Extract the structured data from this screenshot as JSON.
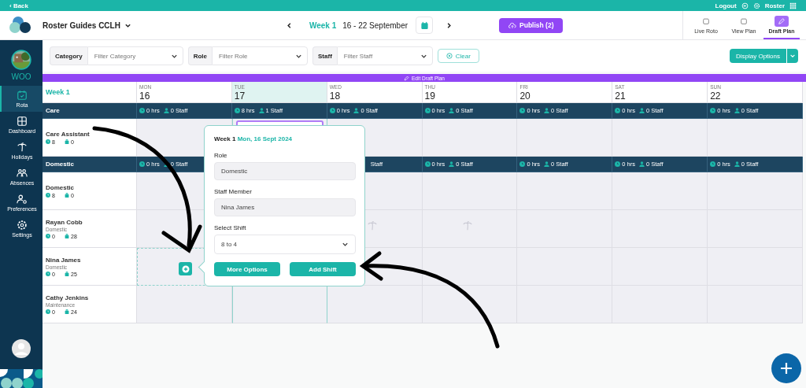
{
  "top_bar": {
    "back": "‹ Back",
    "logout": "Logout",
    "roster": "Roster"
  },
  "header": {
    "org": "Roster Guides CCLH",
    "week_label": "Week 1",
    "week_range": "16 - 22 September",
    "publish": "Publish (2)",
    "views": [
      {
        "label": "Live Roto",
        "selected": false
      },
      {
        "label": "View Plan",
        "selected": false
      },
      {
        "label": "Draft Plan",
        "selected": true
      }
    ]
  },
  "sidebar": {
    "site": "WOO",
    "items": [
      {
        "label": "Rota",
        "selected": true
      },
      {
        "label": "Dashboard",
        "selected": false
      },
      {
        "label": "Holidays",
        "selected": false
      },
      {
        "label": "Absences",
        "selected": false
      },
      {
        "label": "Preferences",
        "selected": false
      },
      {
        "label": "Settings",
        "selected": false
      }
    ]
  },
  "filters": [
    {
      "label": "Category",
      "placeholder": "Filter Category"
    },
    {
      "label": "Role",
      "placeholder": "Filter Role"
    },
    {
      "label": "Staff",
      "placeholder": "Filter Staff"
    }
  ],
  "clear": "Clear",
  "display_options": "Display Options",
  "banner": "Edit Draft Plan",
  "grid": {
    "week": "Week 1",
    "days": [
      {
        "abbr": "MON",
        "date": "16",
        "selected": false
      },
      {
        "abbr": "TUE",
        "date": "17",
        "selected": true
      },
      {
        "abbr": "WED",
        "date": "18",
        "selected": false
      },
      {
        "abbr": "THU",
        "date": "19",
        "selected": false
      },
      {
        "abbr": "FRI",
        "date": "20",
        "selected": false
      },
      {
        "abbr": "SAT",
        "date": "21",
        "selected": false
      },
      {
        "abbr": "SUN",
        "date": "22",
        "selected": false
      }
    ],
    "rows": [
      {
        "kind": "group",
        "name": "Care",
        "totals": [
          {
            "hours": "0 hrs",
            "staff": "0 Staff"
          },
          {
            "hours": "8 hrs",
            "staff": "1 Staff"
          },
          {
            "hours": "0 hrs",
            "staff": "0 Staff"
          },
          {
            "hours": "0 hrs",
            "staff": "0 Staff"
          },
          {
            "hours": "0 hrs",
            "staff": "0 Staff"
          },
          {
            "hours": "0 hrs",
            "staff": "0 Staff"
          },
          {
            "hours": "0 hrs",
            "staff": "0 Staff"
          }
        ]
      },
      {
        "kind": "staff",
        "name": "Care Assistant",
        "hours": "8",
        "count": "0",
        "cells": [
          {
            "kind": "empty"
          },
          {
            "kind": "shift"
          },
          {
            "kind": "empty"
          },
          {
            "kind": "empty"
          },
          {
            "kind": "empty"
          },
          {
            "kind": "empty"
          },
          {
            "kind": "empty"
          }
        ]
      },
      {
        "kind": "group",
        "name": "Domestic",
        "totals": [
          {
            "hours": "0 hrs",
            "staff": "0 Staff"
          },
          {
            "kind": "covered"
          },
          {
            "kind": "partial",
            "staff": "Staff"
          },
          {
            "hours": "0 hrs",
            "staff": "0 Staff"
          },
          {
            "hours": "0 hrs",
            "staff": "0 Staff"
          },
          {
            "hours": "0 hrs",
            "staff": "0 Staff"
          },
          {
            "hours": "0 hrs",
            "staff": "0 Staff"
          }
        ]
      },
      {
        "kind": "staff",
        "name": "Domestic",
        "hours": "8",
        "count": "0",
        "cells": [
          {
            "kind": "empty"
          },
          {
            "kind": "covered"
          },
          {
            "kind": "empty"
          },
          {
            "kind": "empty"
          },
          {
            "kind": "empty"
          },
          {
            "kind": "empty"
          },
          {
            "kind": "empty"
          }
        ]
      },
      {
        "kind": "staff",
        "name": "Rayan Cobb",
        "role": "Domestic",
        "hours": "0",
        "count": "28",
        "cells": [
          {
            "kind": "empty"
          },
          {
            "kind": "covered"
          },
          {
            "kind": "holiday"
          },
          {
            "kind": "holiday"
          },
          {
            "kind": "empty"
          },
          {
            "kind": "empty"
          },
          {
            "kind": "empty"
          }
        ]
      },
      {
        "kind": "staff",
        "name": "Nina James",
        "role": "Domestic",
        "hours": "0",
        "count": "25",
        "cells": [
          {
            "kind": "selected"
          },
          {
            "kind": "covered"
          },
          {
            "kind": "empty"
          },
          {
            "kind": "empty"
          },
          {
            "kind": "empty"
          },
          {
            "kind": "empty"
          },
          {
            "kind": "empty"
          }
        ]
      },
      {
        "kind": "staff",
        "name": "Cathy Jenkins",
        "role": "Maintenance",
        "hours": "0",
        "count": "24",
        "cells": [
          {
            "kind": "empty"
          },
          {
            "kind": "empty"
          },
          {
            "kind": "empty"
          },
          {
            "kind": "empty"
          },
          {
            "kind": "empty"
          },
          {
            "kind": "empty"
          },
          {
            "kind": "empty"
          }
        ]
      }
    ]
  },
  "popover": {
    "week": "Week 1",
    "date": "Mon, 16 Sept 2024",
    "role_label": "Role",
    "role_value": "Domestic",
    "staff_label": "Staff Member",
    "staff_value": "Nina James",
    "shift_label": "Select Shift",
    "shift_value": "8 to 4",
    "more": "More Options",
    "add": "Add Shift"
  }
}
